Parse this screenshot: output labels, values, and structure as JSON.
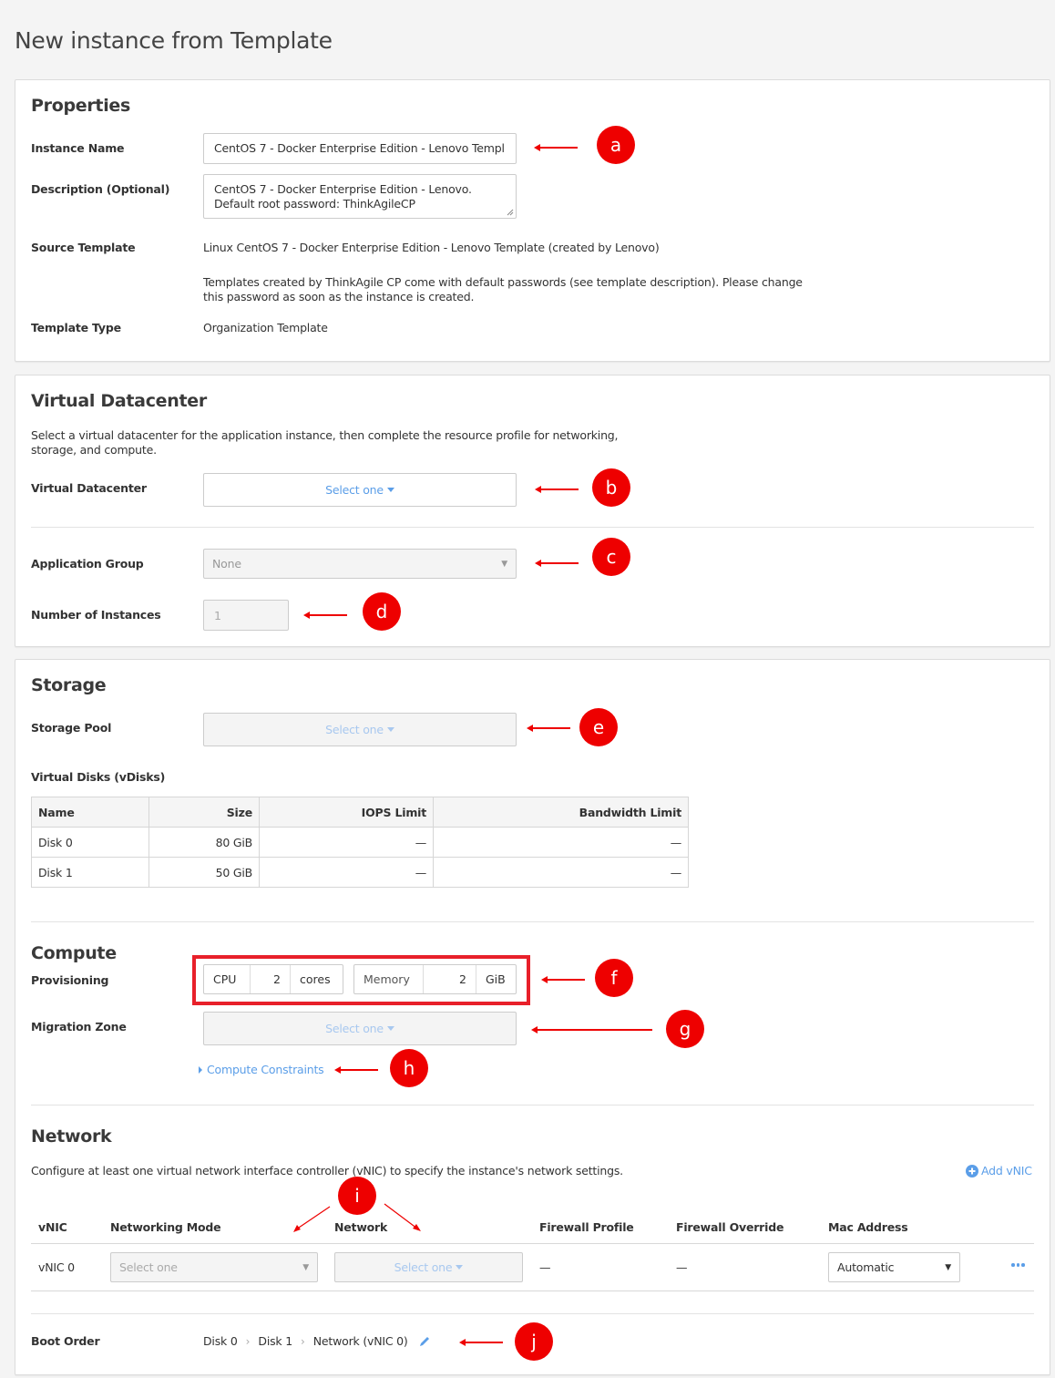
{
  "page": {
    "title": "New instance from Template"
  },
  "properties": {
    "heading": "Properties",
    "instance_name": {
      "label": "Instance Name",
      "value": "CentOS 7 - Docker Enterprise Edition - Lenovo Templ"
    },
    "description": {
      "label": "Description (Optional)",
      "line1": "CentOS 7 - Docker Enterprise Edition - Lenovo.",
      "line2": "Default root password: ThinkAgileCP"
    },
    "source_template": {
      "label": "Source Template",
      "value": "Linux CentOS 7 - Docker Enterprise Edition - Lenovo Template (created by Lenovo)",
      "note_line1": "Templates created by ThinkAgile CP come with default passwords (see template description). Please change",
      "note_line2": "this password as soon as the instance is created."
    },
    "template_type": {
      "label": "Template Type",
      "value": "Organization Template"
    }
  },
  "virtual_datacenter": {
    "heading": "Virtual Datacenter",
    "intro_line1": "Select a virtual datacenter for the application instance, then complete the resource profile for networking,",
    "intro_line2": "storage, and compute.",
    "datacenter": {
      "label": "Virtual Datacenter",
      "value": "Select one"
    },
    "application_group": {
      "label": "Application Group",
      "value": "None"
    },
    "num_instances": {
      "label": "Number of Instances",
      "value": "1"
    }
  },
  "storage": {
    "heading": "Storage",
    "pool": {
      "label": "Storage Pool",
      "value": "Select one"
    },
    "vdisks_label": "Virtual Disks (vDisks)",
    "columns": [
      "Name",
      "Size",
      "IOPS Limit",
      "Bandwidth Limit"
    ],
    "rows": [
      {
        "name": "Disk 0",
        "size": "80 GiB",
        "iops": "—",
        "bandwidth": "—"
      },
      {
        "name": "Disk 1",
        "size": "50 GiB",
        "iops": "—",
        "bandwidth": "—"
      }
    ]
  },
  "compute": {
    "heading": "Compute",
    "provisioning": {
      "label": "Provisioning",
      "cpu_label": "CPU",
      "cpu_value": "2",
      "cpu_unit": "cores",
      "memory_label": "Memory",
      "memory_value": "2",
      "memory_unit": "GiB"
    },
    "migration_zone": {
      "label": "Migration Zone",
      "value": "Select one"
    },
    "constraints_link": "Compute Constraints"
  },
  "network": {
    "heading": "Network",
    "intro": "Configure at least one virtual network interface controller (vNIC) to specify the instance's network settings.",
    "add_vnic": "Add vNIC",
    "columns": [
      "vNIC",
      "Networking Mode",
      "Network",
      "Firewall Profile",
      "Firewall Override",
      "Mac Address"
    ],
    "rows": [
      {
        "vnic": "vNIC 0",
        "mode": "Select one",
        "network": "Select one",
        "firewall_profile": "—",
        "firewall_override": "—",
        "mac": "Automatic"
      }
    ]
  },
  "boot_order": {
    "label": "Boot Order",
    "items": [
      "Disk 0",
      "Disk 1",
      "Network (vNIC 0)"
    ]
  },
  "annotations": [
    "a",
    "b",
    "c",
    "d",
    "e",
    "f",
    "g",
    "h",
    "i",
    "j"
  ],
  "colors": {
    "accent": "#5b9ee8",
    "annotation": "#ee0000",
    "highlight_border": "#e8202a"
  }
}
